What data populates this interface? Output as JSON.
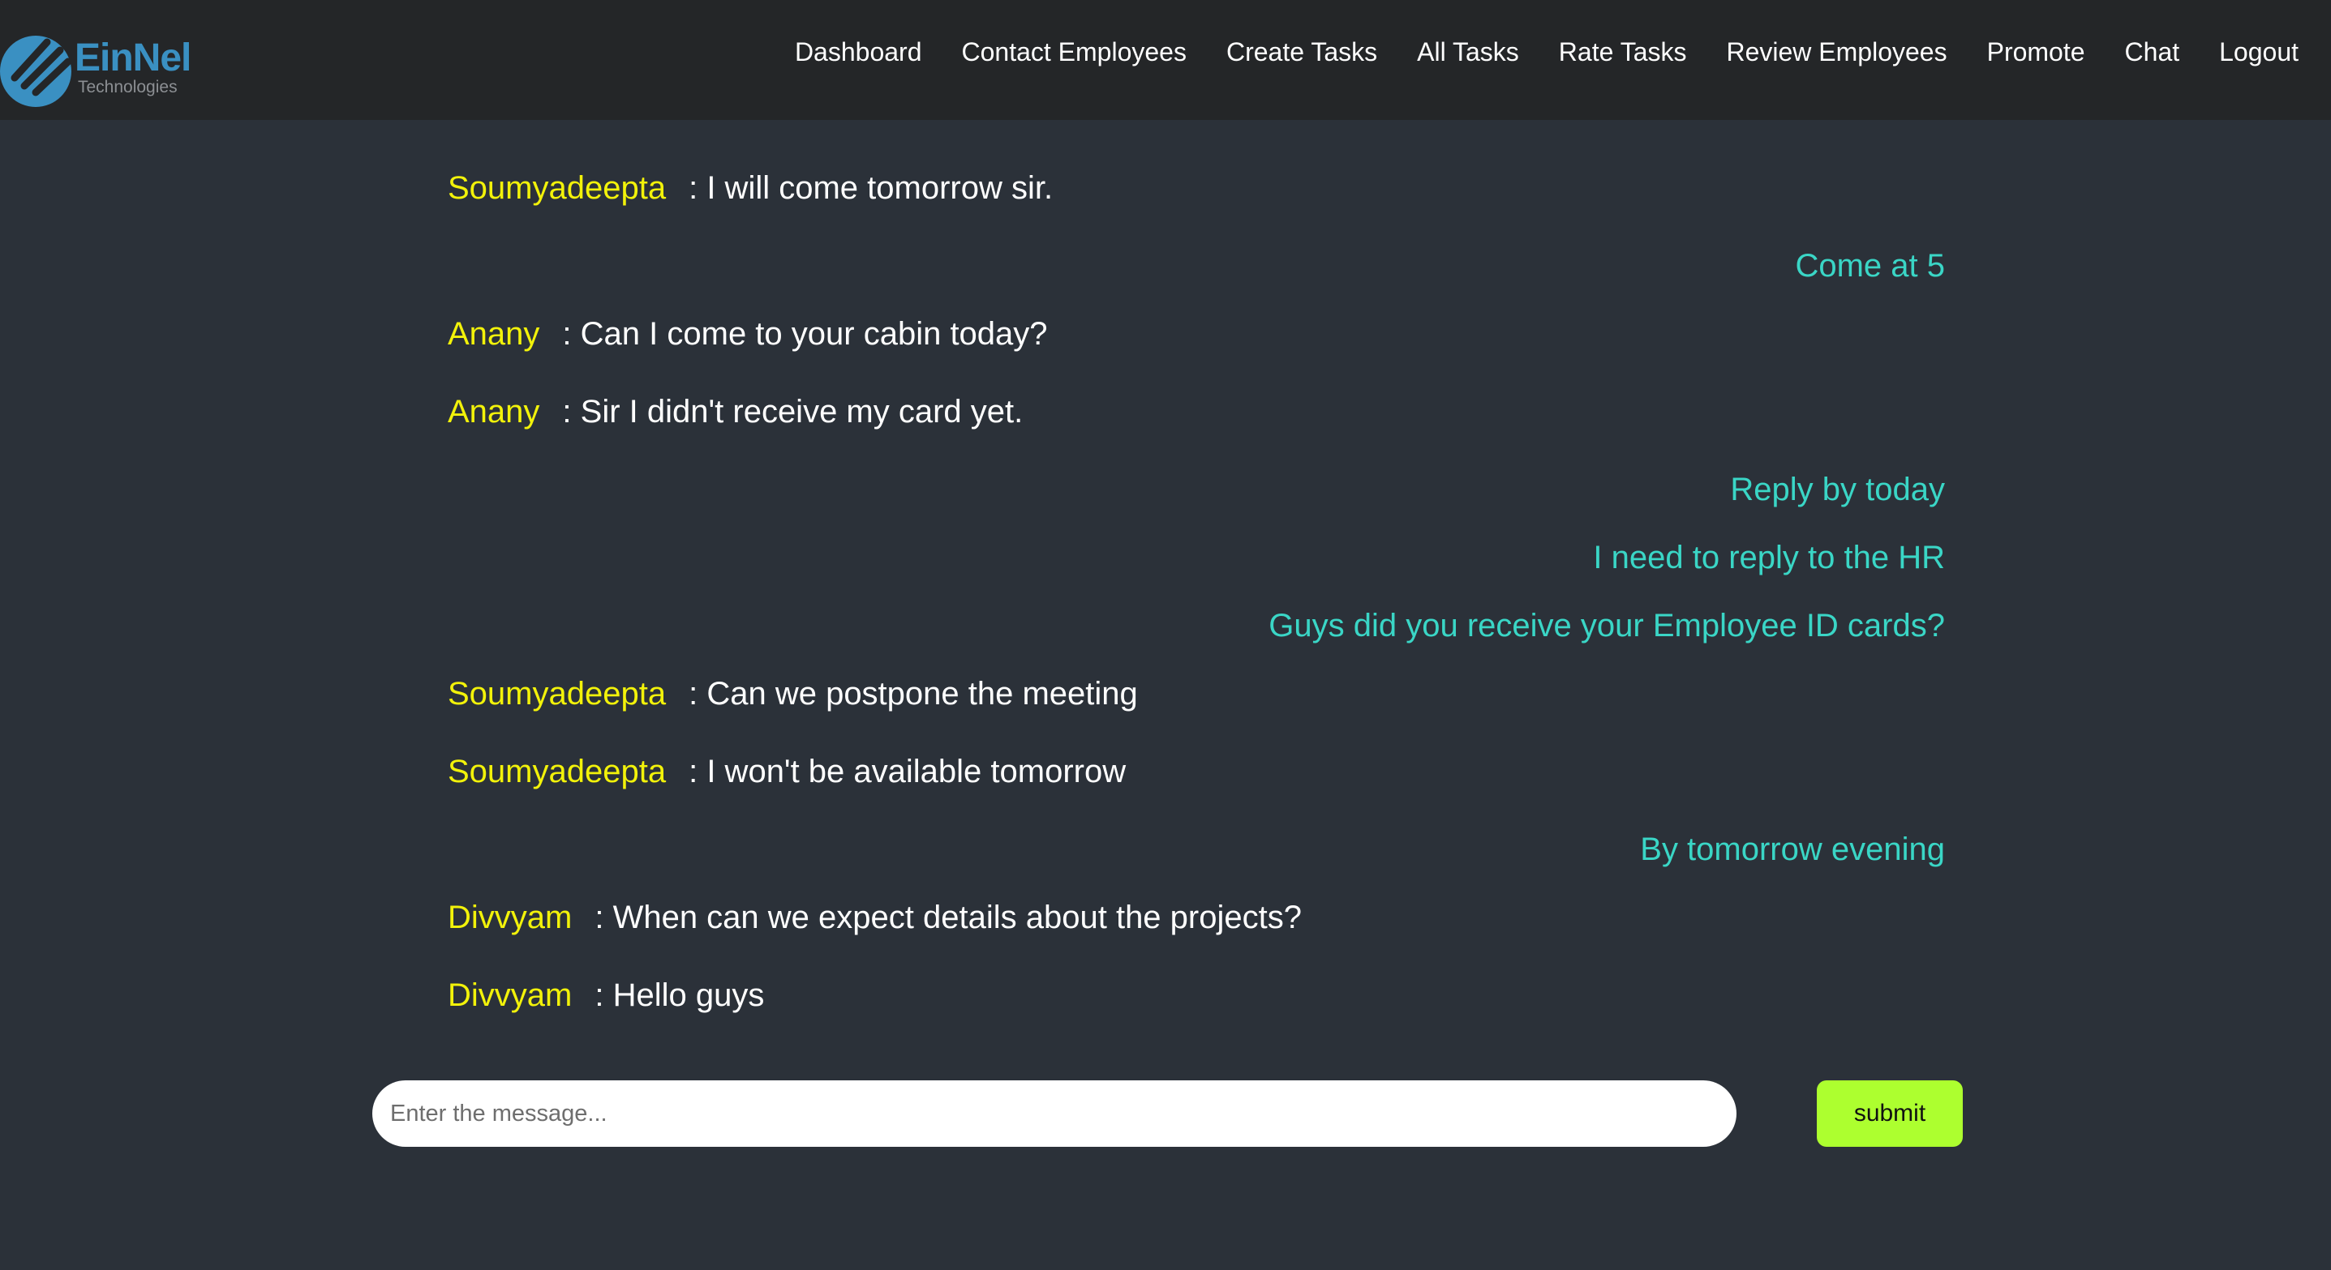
{
  "brand": {
    "name": "EinNel",
    "subtitle": "Technologies",
    "logo_icon": "einnel-logo-icon",
    "color": "#3a90c2"
  },
  "nav": {
    "items": [
      {
        "label": "Dashboard"
      },
      {
        "label": "Contact Employees"
      },
      {
        "label": "Create Tasks"
      },
      {
        "label": "All Tasks"
      },
      {
        "label": "Rate Tasks"
      },
      {
        "label": "Review Employees"
      },
      {
        "label": "Promote"
      },
      {
        "label": "Chat"
      },
      {
        "label": "Logout"
      }
    ]
  },
  "chat": {
    "messages": [
      {
        "type": "incoming",
        "sender": "Soumyadeepta",
        "text": "I will come tomorrow sir."
      },
      {
        "type": "outgoing",
        "text": "Come at 5"
      },
      {
        "type": "incoming",
        "sender": "Anany",
        "text": "Can I come to your cabin today?"
      },
      {
        "type": "incoming",
        "sender": "Anany",
        "text": "Sir I didn't receive my card yet."
      },
      {
        "type": "outgoing",
        "text": "Reply by today"
      },
      {
        "type": "outgoing",
        "text": "I need to reply to the HR"
      },
      {
        "type": "outgoing",
        "text": "Guys did you receive your Employee ID cards?"
      },
      {
        "type": "incoming",
        "sender": "Soumyadeepta",
        "text": "Can we postpone the meeting"
      },
      {
        "type": "incoming",
        "sender": "Soumyadeepta",
        "text": "I won't be available tomorrow"
      },
      {
        "type": "outgoing",
        "text": "By tomorrow evening"
      },
      {
        "type": "incoming",
        "sender": "Divvyam",
        "text": "When can we expect details about the projects?"
      },
      {
        "type": "incoming",
        "sender": "Divvyam",
        "text": "Hello guys"
      }
    ]
  },
  "composer": {
    "placeholder": "Enter the message...",
    "value": "",
    "submit_label": "submit"
  },
  "colors": {
    "background": "#2b3139",
    "navbar": "#242628",
    "sender": "#f2f20a",
    "outgoing": "#3ad6c6",
    "submit": "#adff2f"
  }
}
